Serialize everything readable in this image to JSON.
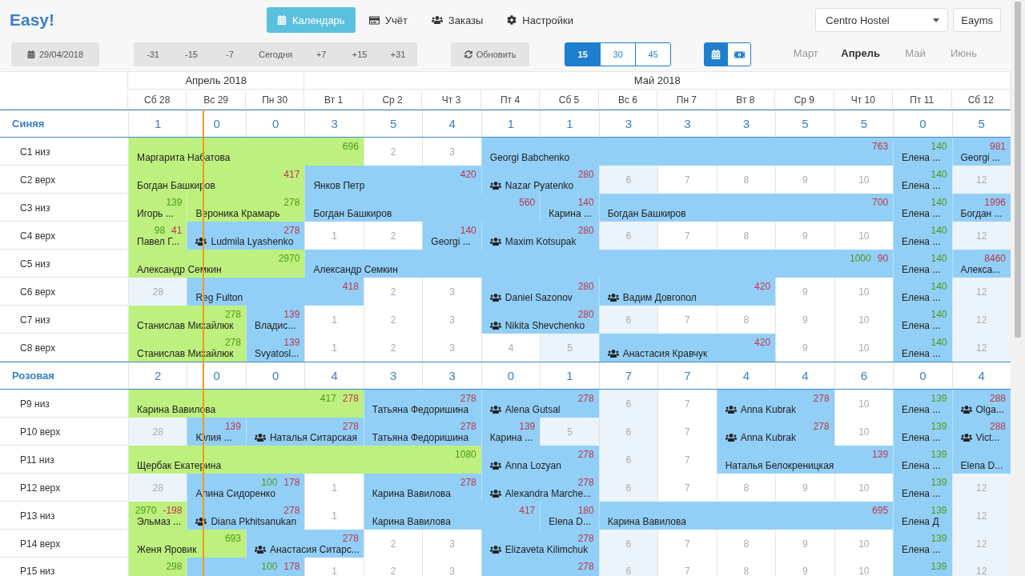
{
  "logo": "Easy!",
  "nav": [
    {
      "label": "Календарь",
      "selected": true
    },
    {
      "label": "Учёт",
      "selected": false
    },
    {
      "label": "Заказы",
      "selected": false
    },
    {
      "label": "Настройки",
      "selected": false
    }
  ],
  "hostel_select": {
    "value": "Centro Hostel"
  },
  "user_button": "Eayms",
  "date_button": "29/04/2018",
  "jump_buttons": [
    "-31",
    "-15",
    "-7",
    "Сегодня",
    "+7",
    "+15",
    "+31"
  ],
  "refresh_button": "Обновить",
  "range_buttons": [
    {
      "label": "15",
      "selected": true
    },
    {
      "label": "30",
      "selected": false
    },
    {
      "label": "45",
      "selected": false
    }
  ],
  "view_buttons": [
    {
      "selected": true
    },
    {
      "selected": false
    }
  ],
  "months": [
    {
      "label": "Март",
      "selected": false
    },
    {
      "label": "Апрель",
      "selected": true
    },
    {
      "label": "Май",
      "selected": false
    },
    {
      "label": "Июнь",
      "selected": false
    }
  ],
  "calendar_months": [
    {
      "label": "Апрель 2018",
      "days": [
        {
          "label": "Сб 28",
          "today": false
        },
        {
          "label": "Вс 29",
          "today": true
        },
        {
          "label": "Пн 30",
          "today": false
        }
      ]
    },
    {
      "label": "Май 2018",
      "days": [
        {
          "label": "Вт 1",
          "today": false
        },
        {
          "label": "Ср 2",
          "today": false
        },
        {
          "label": "Чт 3",
          "today": false
        },
        {
          "label": "Пт 4",
          "today": false
        },
        {
          "label": "Сб 5",
          "today": false
        },
        {
          "label": "Вс 6",
          "today": false
        },
        {
          "label": "Пн 7",
          "today": false
        },
        {
          "label": "Вт 8",
          "today": false
        },
        {
          "label": "Ср 9",
          "today": false
        },
        {
          "label": "Чт 10",
          "today": false
        },
        {
          "label": "Пт 11",
          "today": false
        },
        {
          "label": "Сб 12",
          "today": false
        }
      ]
    }
  ],
  "room_groups": [
    {
      "name": "Синяя",
      "counts": [
        "1",
        "0",
        "0",
        "3",
        "5",
        "4",
        "1",
        "1",
        "3",
        "3",
        "3",
        "5",
        "5",
        "0",
        "5"
      ],
      "rooms": [
        {
          "name": "С1 низ",
          "cells": [
            {
              "kind": "booking",
              "color": "#bdf07e",
              "group": false,
              "name": "Маргарита Набатова",
              "amounts": [
                {
                  "kind": "paid",
                  "text": "696"
                }
              ]
            },
            {
              "kind": "stay"
            },
            {
              "kind": "stay"
            },
            {
              "kind": "stay"
            },
            {
              "kind": "free",
              "text": "2"
            },
            {
              "kind": "free",
              "text": "3"
            },
            {
              "kind": "booking",
              "color": "#92cff7",
              "group": false,
              "name": "Georgi Babchenko",
              "amounts": [
                {
                  "kind": "due",
                  "text": "763"
                }
              ]
            },
            {
              "kind": "stay"
            },
            {
              "kind": "stay"
            },
            {
              "kind": "stay"
            },
            {
              "kind": "stay"
            },
            {
              "kind": "stay"
            },
            {
              "kind": "stay"
            },
            {
              "kind": "booking",
              "color": "#92cff7",
              "group": false,
              "name": "Елена ...",
              "amounts": [
                {
                  "kind": "paid",
                  "text": "140"
                }
              ]
            },
            {
              "kind": "booking",
              "color": "#92cff7",
              "group": false,
              "name": "Georgi ...",
              "amounts": [
                {
                  "kind": "due",
                  "text": "981"
                }
              ]
            }
          ]
        },
        {
          "name": "С2 верх",
          "cells": [
            {
              "kind": "booking",
              "color": "#bdf07e",
              "group": false,
              "name": "Богдан Башкиров",
              "amounts": [
                {
                  "kind": "due",
                  "text": "417"
                }
              ]
            },
            {
              "kind": "stay"
            },
            {
              "kind": "stay"
            },
            {
              "kind": "booking",
              "color": "#92cff7",
              "group": false,
              "name": "Янков Петр",
              "amounts": [
                {
                  "kind": "due",
                  "text": "420"
                }
              ]
            },
            {
              "kind": "stay"
            },
            {
              "kind": "stay"
            },
            {
              "kind": "booking",
              "color": "#92cff7",
              "group": true,
              "name": "Nazar Pyatenko",
              "amounts": [
                {
                  "kind": "due",
                  "text": "280"
                }
              ]
            },
            {
              "kind": "stay"
            },
            {
              "kind": "weekend",
              "text": "6"
            },
            {
              "kind": "free",
              "text": "7"
            },
            {
              "kind": "free",
              "text": "8"
            },
            {
              "kind": "free",
              "text": "9"
            },
            {
              "kind": "free",
              "text": "10"
            },
            {
              "kind": "booking",
              "color": "#92cff7",
              "group": false,
              "name": "Елена ...",
              "amounts": [
                {
                  "kind": "paid",
                  "text": "140"
                }
              ]
            },
            {
              "kind": "weekend",
              "text": "12"
            }
          ]
        },
        {
          "name": "С3 низ",
          "cells": [
            {
              "kind": "booking",
              "color": "#bdf07e",
              "group": false,
              "name": "Игорь ...",
              "amounts": [
                {
                  "kind": "paid",
                  "text": "139"
                }
              ]
            },
            {
              "kind": "booking",
              "color": "#bdf07e",
              "group": false,
              "name": "Вероника Крамарь",
              "amounts": [
                {
                  "kind": "paid",
                  "text": "278"
                }
              ]
            },
            {
              "kind": "stay"
            },
            {
              "kind": "booking",
              "color": "#92cff7",
              "group": false,
              "name": "Богдан Башкиров",
              "amounts": [
                {
                  "kind": "due",
                  "text": "560"
                }
              ]
            },
            {
              "kind": "stay"
            },
            {
              "kind": "stay"
            },
            {
              "kind": "stay"
            },
            {
              "kind": "booking",
              "color": "#92cff7",
              "group": false,
              "name": "Карина ...",
              "amounts": [
                {
                  "kind": "due",
                  "text": "140"
                }
              ]
            },
            {
              "kind": "booking",
              "color": "#92cff7",
              "group": false,
              "name": "Богдан Башкиров",
              "amounts": [
                {
                  "kind": "due",
                  "text": "700"
                }
              ]
            },
            {
              "kind": "stay"
            },
            {
              "kind": "stay"
            },
            {
              "kind": "stay"
            },
            {
              "kind": "stay"
            },
            {
              "kind": "booking",
              "color": "#92cff7",
              "group": false,
              "name": "Елена ...",
              "amounts": [
                {
                  "kind": "paid",
                  "text": "140"
                }
              ]
            },
            {
              "kind": "booking",
              "color": "#92cff7",
              "group": false,
              "name": "Богдан ...",
              "amounts": [
                {
                  "kind": "due",
                  "text": "1996"
                }
              ]
            }
          ]
        },
        {
          "name": "С4 верх",
          "cells": [
            {
              "kind": "booking",
              "color": "#bdf07e",
              "group": false,
              "name": "Павел Г...",
              "amounts": [
                {
                  "kind": "paid",
                  "text": "98"
                },
                {
                  "kind": "due",
                  "text": "41"
                }
              ]
            },
            {
              "kind": "booking",
              "color": "#92cff7",
              "group": true,
              "name": "Ludmila Lyashenko",
              "amounts": [
                {
                  "kind": "due",
                  "text": "278"
                }
              ]
            },
            {
              "kind": "stay"
            },
            {
              "kind": "free",
              "text": "1"
            },
            {
              "kind": "free",
              "text": "2"
            },
            {
              "kind": "booking",
              "color": "#92cff7",
              "group": false,
              "name": "Georgi ...",
              "amounts": [
                {
                  "kind": "due",
                  "text": "140"
                }
              ]
            },
            {
              "kind": "booking",
              "color": "#92cff7",
              "group": true,
              "name": "Maxim Kotsupak",
              "amounts": [
                {
                  "kind": "due",
                  "text": "280"
                }
              ]
            },
            {
              "kind": "stay"
            },
            {
              "kind": "weekend",
              "text": "6"
            },
            {
              "kind": "free",
              "text": "7"
            },
            {
              "kind": "free",
              "text": "8"
            },
            {
              "kind": "free",
              "text": "9"
            },
            {
              "kind": "free",
              "text": "10"
            },
            {
              "kind": "booking",
              "color": "#92cff7",
              "group": false,
              "name": "Елена ...",
              "amounts": [
                {
                  "kind": "paid",
                  "text": "140"
                }
              ]
            },
            {
              "kind": "weekend",
              "text": "12"
            }
          ]
        },
        {
          "name": "С5 низ",
          "cells": [
            {
              "kind": "booking",
              "color": "#bdf07e",
              "group": false,
              "name": "Александр Семкин",
              "amounts": [
                {
                  "kind": "paid",
                  "text": "2970"
                }
              ]
            },
            {
              "kind": "stay"
            },
            {
              "kind": "stay"
            },
            {
              "kind": "booking",
              "color": "#92cff7",
              "group": false,
              "name": "Александр Семкин",
              "amounts": [
                {
                  "kind": "paid",
                  "text": "1000"
                },
                {
                  "kind": "due",
                  "text": "90"
                }
              ]
            },
            {
              "kind": "stay"
            },
            {
              "kind": "stay"
            },
            {
              "kind": "stay"
            },
            {
              "kind": "stay"
            },
            {
              "kind": "stay"
            },
            {
              "kind": "stay"
            },
            {
              "kind": "stay"
            },
            {
              "kind": "stay"
            },
            {
              "kind": "stay"
            },
            {
              "kind": "booking",
              "color": "#92cff7",
              "group": false,
              "name": "Елена ...",
              "amounts": [
                {
                  "kind": "paid",
                  "text": "140"
                }
              ]
            },
            {
              "kind": "booking",
              "color": "#92cff7",
              "group": false,
              "name": "Алекса...",
              "amounts": [
                {
                  "kind": "due",
                  "text": "8460"
                }
              ]
            }
          ]
        },
        {
          "name": "С6 верх",
          "cells": [
            {
              "kind": "weekend",
              "text": "28"
            },
            {
              "kind": "booking",
              "color": "#92cff7",
              "group": false,
              "name": "Reg Fulton",
              "amounts": [
                {
                  "kind": "due",
                  "text": "418"
                }
              ]
            },
            {
              "kind": "stay"
            },
            {
              "kind": "stay"
            },
            {
              "kind": "free",
              "text": "2"
            },
            {
              "kind": "free",
              "text": "3"
            },
            {
              "kind": "booking",
              "color": "#92cff7",
              "group": true,
              "name": "Daniel Sazonov",
              "amounts": [
                {
                  "kind": "due",
                  "text": "280"
                }
              ]
            },
            {
              "kind": "stay"
            },
            {
              "kind": "booking",
              "color": "#92cff7",
              "group": true,
              "name": "Вадим Довгопол",
              "amounts": [
                {
                  "kind": "due",
                  "text": "420"
                }
              ]
            },
            {
              "kind": "stay"
            },
            {
              "kind": "stay"
            },
            {
              "kind": "free",
              "text": "9"
            },
            {
              "kind": "free",
              "text": "10"
            },
            {
              "kind": "booking",
              "color": "#92cff7",
              "group": false,
              "name": "Елена ...",
              "amounts": [
                {
                  "kind": "paid",
                  "text": "140"
                }
              ]
            },
            {
              "kind": "weekend",
              "text": "12"
            }
          ]
        },
        {
          "name": "С7 низ",
          "cells": [
            {
              "kind": "booking",
              "color": "#bdf07e",
              "group": false,
              "name": "Станислав Михайлюк",
              "amounts": [
                {
                  "kind": "paid",
                  "text": "278"
                }
              ]
            },
            {
              "kind": "stay"
            },
            {
              "kind": "booking",
              "color": "#92cff7",
              "group": false,
              "name": "Владис...",
              "amounts": [
                {
                  "kind": "due",
                  "text": "139"
                }
              ]
            },
            {
              "kind": "free",
              "text": "1"
            },
            {
              "kind": "free",
              "text": "2"
            },
            {
              "kind": "free",
              "text": "3"
            },
            {
              "kind": "booking",
              "color": "#92cff7",
              "group": true,
              "name": "Nikita Shevchenko",
              "amounts": [
                {
                  "kind": "due",
                  "text": "280"
                }
              ]
            },
            {
              "kind": "stay"
            },
            {
              "kind": "weekend",
              "text": "6"
            },
            {
              "kind": "free",
              "text": "7"
            },
            {
              "kind": "free",
              "text": "8"
            },
            {
              "kind": "free",
              "text": "9"
            },
            {
              "kind": "free",
              "text": "10"
            },
            {
              "kind": "booking",
              "color": "#92cff7",
              "group": false,
              "name": "Елена ...",
              "amounts": [
                {
                  "kind": "paid",
                  "text": "140"
                }
              ]
            },
            {
              "kind": "weekend",
              "text": "12"
            }
          ]
        },
        {
          "name": "С8 верх",
          "cells": [
            {
              "kind": "booking",
              "color": "#bdf07e",
              "group": false,
              "name": "Станислав Михайлюк",
              "amounts": [
                {
                  "kind": "paid",
                  "text": "278"
                }
              ]
            },
            {
              "kind": "stay"
            },
            {
              "kind": "booking",
              "color": "#92cff7",
              "group": false,
              "name": "Svyatosl...",
              "amounts": [
                {
                  "kind": "due",
                  "text": "139"
                }
              ]
            },
            {
              "kind": "free",
              "text": "1"
            },
            {
              "kind": "free",
              "text": "2"
            },
            {
              "kind": "free",
              "text": "3"
            },
            {
              "kind": "free",
              "text": "4"
            },
            {
              "kind": "weekend",
              "text": "5"
            },
            {
              "kind": "booking",
              "color": "#92cff7",
              "group": true,
              "name": "Анастасия Кравчук",
              "amounts": [
                {
                  "kind": "due",
                  "text": "420"
                }
              ]
            },
            {
              "kind": "stay"
            },
            {
              "kind": "stay"
            },
            {
              "kind": "free",
              "text": "9"
            },
            {
              "kind": "free",
              "text": "10"
            },
            {
              "kind": "booking",
              "color": "#92cff7",
              "group": false,
              "name": "Елена ...",
              "amounts": [
                {
                  "kind": "paid",
                  "text": "140"
                }
              ]
            },
            {
              "kind": "weekend",
              "text": "12"
            }
          ]
        }
      ]
    },
    {
      "name": "Розовая",
      "counts": [
        "2",
        "0",
        "0",
        "4",
        "3",
        "3",
        "0",
        "1",
        "7",
        "7",
        "4",
        "4",
        "6",
        "0",
        "4"
      ],
      "rooms": [
        {
          "name": "Р9 низ",
          "cells": [
            {
              "kind": "booking",
              "color": "#bdf07e",
              "group": false,
              "name": "Карина Вавилова",
              "amounts": [
                {
                  "kind": "paid",
                  "text": "417"
                },
                {
                  "kind": "due",
                  "text": "278"
                }
              ]
            },
            {
              "kind": "stay"
            },
            {
              "kind": "stay"
            },
            {
              "kind": "stay"
            },
            {
              "kind": "booking",
              "color": "#92cff7",
              "group": false,
              "name": "Татьяна Федоришина",
              "amounts": [
                {
                  "kind": "due",
                  "text": "278"
                }
              ]
            },
            {
              "kind": "stay"
            },
            {
              "kind": "booking",
              "color": "#92cff7",
              "group": true,
              "name": "Alena Gutsal",
              "amounts": [
                {
                  "kind": "due",
                  "text": "278"
                }
              ]
            },
            {
              "kind": "stay"
            },
            {
              "kind": "weekend",
              "text": "6"
            },
            {
              "kind": "free",
              "text": "7"
            },
            {
              "kind": "booking",
              "color": "#92cff7",
              "group": true,
              "name": "Anna Kubrak",
              "amounts": [
                {
                  "kind": "due",
                  "text": "278"
                }
              ]
            },
            {
              "kind": "stay"
            },
            {
              "kind": "free",
              "text": "10"
            },
            {
              "kind": "booking",
              "color": "#92cff7",
              "group": false,
              "name": "Елена ...",
              "amounts": [
                {
                  "kind": "paid",
                  "text": "139"
                }
              ]
            },
            {
              "kind": "booking",
              "color": "#92cff7",
              "group": true,
              "name": "Olga...",
              "amounts": [
                {
                  "kind": "due",
                  "text": "288"
                }
              ]
            }
          ]
        },
        {
          "name": "Р10 верх",
          "cells": [
            {
              "kind": "weekend",
              "text": "28"
            },
            {
              "kind": "booking",
              "color": "#92cff7",
              "group": false,
              "name": "Юлия ...",
              "amounts": [
                {
                  "kind": "due",
                  "text": "139"
                }
              ]
            },
            {
              "kind": "booking",
              "color": "#92cff7",
              "group": true,
              "name": "Наталья Ситарская",
              "amounts": [
                {
                  "kind": "due",
                  "text": "278"
                }
              ]
            },
            {
              "kind": "stay"
            },
            {
              "kind": "booking",
              "color": "#92cff7",
              "group": false,
              "name": "Татьяна Федоришина",
              "amounts": [
                {
                  "kind": "due",
                  "text": "278"
                }
              ]
            },
            {
              "kind": "stay"
            },
            {
              "kind": "booking",
              "color": "#92cff7",
              "group": false,
              "name": "Карина ...",
              "amounts": [
                {
                  "kind": "due",
                  "text": "139"
                }
              ]
            },
            {
              "kind": "weekend",
              "text": "5"
            },
            {
              "kind": "weekend",
              "text": "6"
            },
            {
              "kind": "free",
              "text": "7"
            },
            {
              "kind": "booking",
              "color": "#92cff7",
              "group": true,
              "name": "Anna Kubrak",
              "amounts": [
                {
                  "kind": "due",
                  "text": "278"
                }
              ]
            },
            {
              "kind": "stay"
            },
            {
              "kind": "free",
              "text": "10"
            },
            {
              "kind": "booking",
              "color": "#92cff7",
              "group": false,
              "name": "Елена ...",
              "amounts": [
                {
                  "kind": "paid",
                  "text": "139"
                }
              ]
            },
            {
              "kind": "booking",
              "color": "#92cff7",
              "group": true,
              "name": "Vict...",
              "amounts": [
                {
                  "kind": "due",
                  "text": "288"
                }
              ]
            }
          ]
        },
        {
          "name": "Р11 низ",
          "cells": [
            {
              "kind": "booking",
              "color": "#bdf07e",
              "group": false,
              "name": "Щербак Екатерина",
              "amounts": [
                {
                  "kind": "paid",
                  "text": "1080"
                }
              ]
            },
            {
              "kind": "stay"
            },
            {
              "kind": "stay"
            },
            {
              "kind": "stay"
            },
            {
              "kind": "stay"
            },
            {
              "kind": "stay"
            },
            {
              "kind": "booking",
              "color": "#92cff7",
              "group": true,
              "name": "Anna Lozyan",
              "amounts": [
                {
                  "kind": "due",
                  "text": "278"
                }
              ]
            },
            {
              "kind": "stay"
            },
            {
              "kind": "weekend",
              "text": "6"
            },
            {
              "kind": "free",
              "text": "7"
            },
            {
              "kind": "booking",
              "color": "#92cff7",
              "group": false,
              "name": "Наталья Белокреницкая",
              "amounts": [
                {
                  "kind": "due",
                  "text": "139"
                }
              ]
            },
            {
              "kind": "stay"
            },
            {
              "kind": "stay"
            },
            {
              "kind": "booking",
              "color": "#92cff7",
              "group": false,
              "name": "Елена ...",
              "amounts": [
                {
                  "kind": "paid",
                  "text": "139"
                }
              ]
            },
            {
              "kind": "booking",
              "color": "#92cff7",
              "group": false,
              "name": "Elena D..."
            }
          ]
        },
        {
          "name": "Р12 верх",
          "cells": [
            {
              "kind": "weekend",
              "text": "28"
            },
            {
              "kind": "booking",
              "color": "#92cff7",
              "group": false,
              "name": "Алина Сидоренко",
              "amounts": [
                {
                  "kind": "paid",
                  "text": "100"
                },
                {
                  "kind": "due",
                  "text": "178"
                }
              ]
            },
            {
              "kind": "stay"
            },
            {
              "kind": "free",
              "text": "1"
            },
            {
              "kind": "booking",
              "color": "#92cff7",
              "group": false,
              "name": "Карина Вавилова",
              "amounts": [
                {
                  "kind": "due",
                  "text": "278"
                }
              ]
            },
            {
              "kind": "stay"
            },
            {
              "kind": "booking",
              "color": "#92cff7",
              "group": true,
              "name": "Alexandra Marche...",
              "amounts": [
                {
                  "kind": "due",
                  "text": "278"
                }
              ]
            },
            {
              "kind": "stay"
            },
            {
              "kind": "weekend",
              "text": "6"
            },
            {
              "kind": "free",
              "text": "7"
            },
            {
              "kind": "free",
              "text": "8"
            },
            {
              "kind": "free",
              "text": "9"
            },
            {
              "kind": "free",
              "text": "10"
            },
            {
              "kind": "booking",
              "color": "#92cff7",
              "group": false,
              "name": "Елена ...",
              "amounts": [
                {
                  "kind": "paid",
                  "text": "139"
                }
              ]
            },
            {
              "kind": "weekend",
              "text": "12"
            }
          ]
        },
        {
          "name": "Р13 низ",
          "cells": [
            {
              "kind": "booking",
              "color": "#bdf07e",
              "group": false,
              "name": "Эльмаз ...",
              "amounts": [
                {
                  "kind": "paid",
                  "text": "2970"
                },
                {
                  "kind": "due",
                  "text": "-198"
                }
              ]
            },
            {
              "kind": "booking",
              "color": "#92cff7",
              "group": true,
              "name": "Diana Pkhitsanukan",
              "amounts": [
                {
                  "kind": "due",
                  "text": "278"
                }
              ]
            },
            {
              "kind": "stay"
            },
            {
              "kind": "free",
              "text": "1"
            },
            {
              "kind": "booking",
              "color": "#92cff7",
              "group": false,
              "name": "Карина Вавилова",
              "amounts": [
                {
                  "kind": "due",
                  "text": "417"
                }
              ]
            },
            {
              "kind": "stay"
            },
            {
              "kind": "stay"
            },
            {
              "kind": "booking",
              "color": "#92cff7",
              "group": false,
              "name": "Elena D...",
              "amounts": [
                {
                  "kind": "due",
                  "text": "180"
                }
              ]
            },
            {
              "kind": "booking",
              "color": "#92cff7",
              "group": false,
              "name": "Карина Вавилова",
              "amounts": [
                {
                  "kind": "due",
                  "text": "695"
                }
              ]
            },
            {
              "kind": "stay"
            },
            {
              "kind": "stay"
            },
            {
              "kind": "stay"
            },
            {
              "kind": "stay"
            },
            {
              "kind": "booking",
              "color": "#92cff7",
              "group": false,
              "name": "Елена Д",
              "amounts": [
                {
                  "kind": "paid",
                  "text": "139"
                }
              ]
            },
            {
              "kind": "weekend",
              "text": "12"
            }
          ]
        },
        {
          "name": "Р14 верх",
          "cells": [
            {
              "kind": "booking",
              "color": "#bdf07e",
              "group": false,
              "name": "Женя Яровик",
              "amounts": [
                {
                  "kind": "paid",
                  "text": "693"
                }
              ]
            },
            {
              "kind": "stay"
            },
            {
              "kind": "booking",
              "color": "#92cff7",
              "group": true,
              "name": "Анастасия Ситарс...",
              "amounts": [
                {
                  "kind": "due",
                  "text": "278"
                }
              ]
            },
            {
              "kind": "stay"
            },
            {
              "kind": "free",
              "text": "2"
            },
            {
              "kind": "free",
              "text": "3"
            },
            {
              "kind": "booking",
              "color": "#92cff7",
              "group": true,
              "name": "Elizaveta Kilimchuk",
              "amounts": [
                {
                  "kind": "due",
                  "text": "278"
                }
              ]
            },
            {
              "kind": "stay"
            },
            {
              "kind": "weekend",
              "text": "6"
            },
            {
              "kind": "free",
              "text": "7"
            },
            {
              "kind": "free",
              "text": "8"
            },
            {
              "kind": "free",
              "text": "9"
            },
            {
              "kind": "free",
              "text": "10"
            },
            {
              "kind": "booking",
              "color": "#92cff7",
              "group": false,
              "name": "Елена ...",
              "amounts": [
                {
                  "kind": "paid",
                  "text": "139"
                }
              ]
            },
            {
              "kind": "weekend",
              "text": "12"
            }
          ]
        },
        {
          "name": "Р15 низ",
          "cells": [
            {
              "kind": "booking",
              "color": "#bdf07e",
              "group": false,
              "amounts": [
                {
                  "kind": "paid",
                  "text": "298"
                }
              ]
            },
            {
              "kind": "booking",
              "color": "#92cff7",
              "group": false,
              "amounts": [
                {
                  "kind": "paid",
                  "text": "100"
                },
                {
                  "kind": "due",
                  "text": "178"
                }
              ]
            },
            {
              "kind": "stay"
            },
            {
              "kind": "free",
              "text": "1"
            },
            {
              "kind": "free",
              "text": "2"
            },
            {
              "kind": "free",
              "text": "3"
            },
            {
              "kind": "booking",
              "color": "#92cff7",
              "group": false,
              "amounts": [
                {
                  "kind": "due",
                  "text": "278"
                }
              ]
            },
            {
              "kind": "stay"
            },
            {
              "kind": "weekend",
              "text": "6"
            },
            {
              "kind": "free",
              "text": "7"
            },
            {
              "kind": "free",
              "text": "8"
            },
            {
              "kind": "free",
              "text": "9"
            },
            {
              "kind": "free",
              "text": "10"
            },
            {
              "kind": "booking",
              "color": "#92cff7",
              "group": false,
              "amounts": [
                {
                  "kind": "paid",
                  "text": "139"
                }
              ]
            },
            {
              "kind": "weekend",
              "text": "12"
            }
          ]
        }
      ]
    }
  ]
}
